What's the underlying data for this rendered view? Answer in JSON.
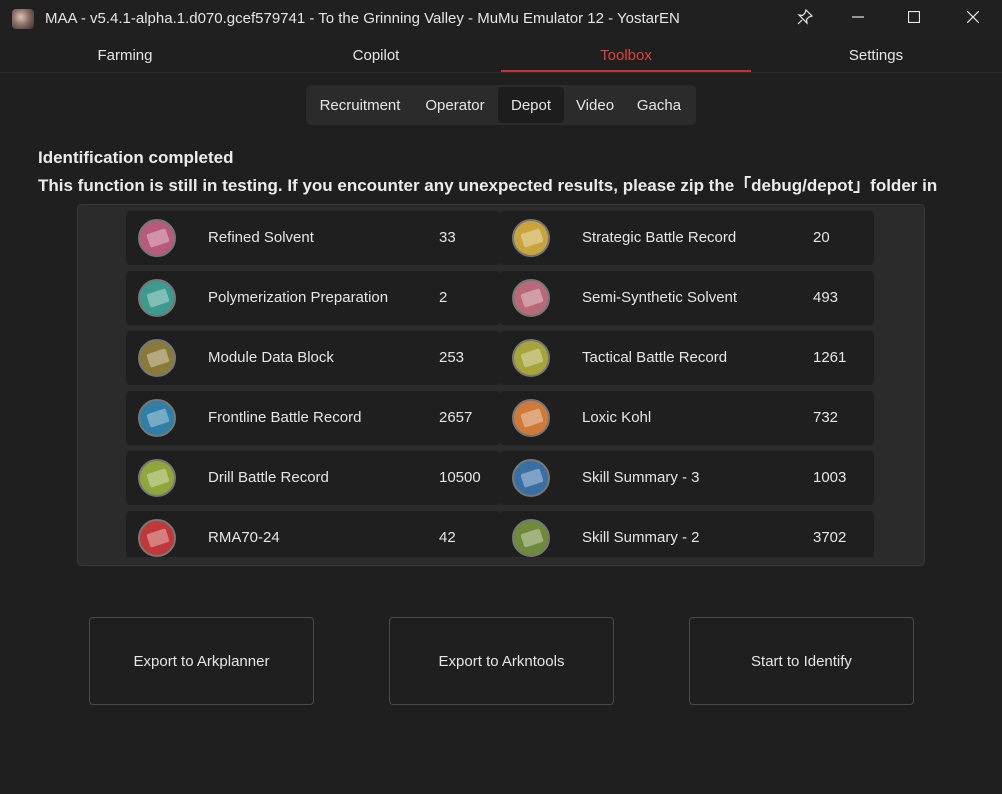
{
  "window": {
    "title": "MAA - v5.4.1-alpha.1.d070.gcef579741 - To the Grinning Valley - MuMu Emulator 12 - YostarEN",
    "controls": {
      "pin_icon": "pin-icon",
      "min_icon": "minimize-icon",
      "max_icon": "maximize-icon",
      "close_icon": "close-icon"
    }
  },
  "main_tabs": [
    {
      "label": "Farming"
    },
    {
      "label": "Copilot"
    },
    {
      "label": "Toolbox",
      "active": true
    },
    {
      "label": "Settings"
    }
  ],
  "sub_tabs": [
    {
      "label": "Recruitment"
    },
    {
      "label": "Operator"
    },
    {
      "label": "Depot",
      "active": true
    },
    {
      "label": "Video"
    },
    {
      "label": "Gacha"
    }
  ],
  "status": {
    "line1": "Identification completed",
    "line2": "This function is still in testing. If you encounter any unexpected results, please zip the「debug/depot」folder in"
  },
  "depot_items": [
    {
      "name": "Refined Solvent",
      "count": "33",
      "icon_color": "#b85a7c"
    },
    {
      "name": "Strategic Battle Record",
      "count": "20",
      "icon_color": "#c9a43c"
    },
    {
      "name": "Polymerization Preparation",
      "count": "2",
      "icon_color": "#3c9a8f"
    },
    {
      "name": "Semi-Synthetic Solvent",
      "count": "493",
      "icon_color": "#b86a78"
    },
    {
      "name": "Module Data Block",
      "count": "253",
      "icon_color": "#8a7a3a"
    },
    {
      "name": "Tactical Battle Record",
      "count": "1261",
      "icon_color": "#a7a43a"
    },
    {
      "name": "Frontline Battle Record",
      "count": "2657",
      "icon_color": "#2f7fa6"
    },
    {
      "name": "Loxic Kohl",
      "count": "732",
      "icon_color": "#d07a3a"
    },
    {
      "name": "Drill Battle Record",
      "count": "10500",
      "icon_color": "#8fa63a"
    },
    {
      "name": "Skill Summary - 3",
      "count": "1003",
      "icon_color": "#3a6fa6"
    },
    {
      "name": "RMA70-24",
      "count": "42",
      "icon_color": "#c0393a"
    },
    {
      "name": "Skill Summary - 2",
      "count": "3702",
      "icon_color": "#6f8a3a"
    }
  ],
  "actions": {
    "export_arkplanner": "Export to Arkplanner",
    "export_arkntools": "Export to Arkntools",
    "start_identify": "Start to Identify"
  }
}
